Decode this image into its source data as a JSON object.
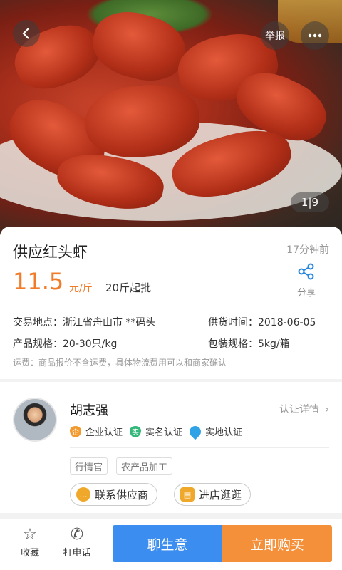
{
  "hero": {
    "report_label": "举报",
    "back_icon": "back-chevron-icon",
    "more_icon": "more-dots-icon",
    "pager": "1|9"
  },
  "product": {
    "title": "供应红头虾",
    "time_ago": "17分钟前",
    "price": "11.5",
    "unit": "元/斤",
    "min_order": "20斤起批",
    "share_label": "分享",
    "trade_location_label": "交易地点：",
    "trade_location": "浙江省舟山市 **码头",
    "supply_time_label": "供货时间：",
    "supply_time": "2018-06-05",
    "spec_label": "产品规格：",
    "spec": "20-30只/kg",
    "package_label": "包装规格：",
    "package": "5kg/箱",
    "shipping_note": "运费：商品报价不含运费，具体物流费用可以和商家确认"
  },
  "seller": {
    "name": "胡志强",
    "cert_detail": "认证详情",
    "badges": [
      {
        "icon_text": "企",
        "label": "企业认证"
      },
      {
        "icon_text": "实",
        "label": "实名认证"
      },
      {
        "icon_text": "",
        "label": "实地认证"
      }
    ],
    "tags": [
      "行情官",
      "农产品加工"
    ],
    "contact_label": "联系供应商",
    "shop_label": "进店逛逛"
  },
  "bottom": {
    "favorite_label": "收藏",
    "call_label": "打电话",
    "chat_label": "聊生意",
    "buy_label": "立即购买"
  },
  "colors": {
    "accent_orange": "#f07c2a",
    "chat_blue": "#3b8df0",
    "buy_orange": "#f5903a",
    "link_blue": "#2a88e0"
  }
}
